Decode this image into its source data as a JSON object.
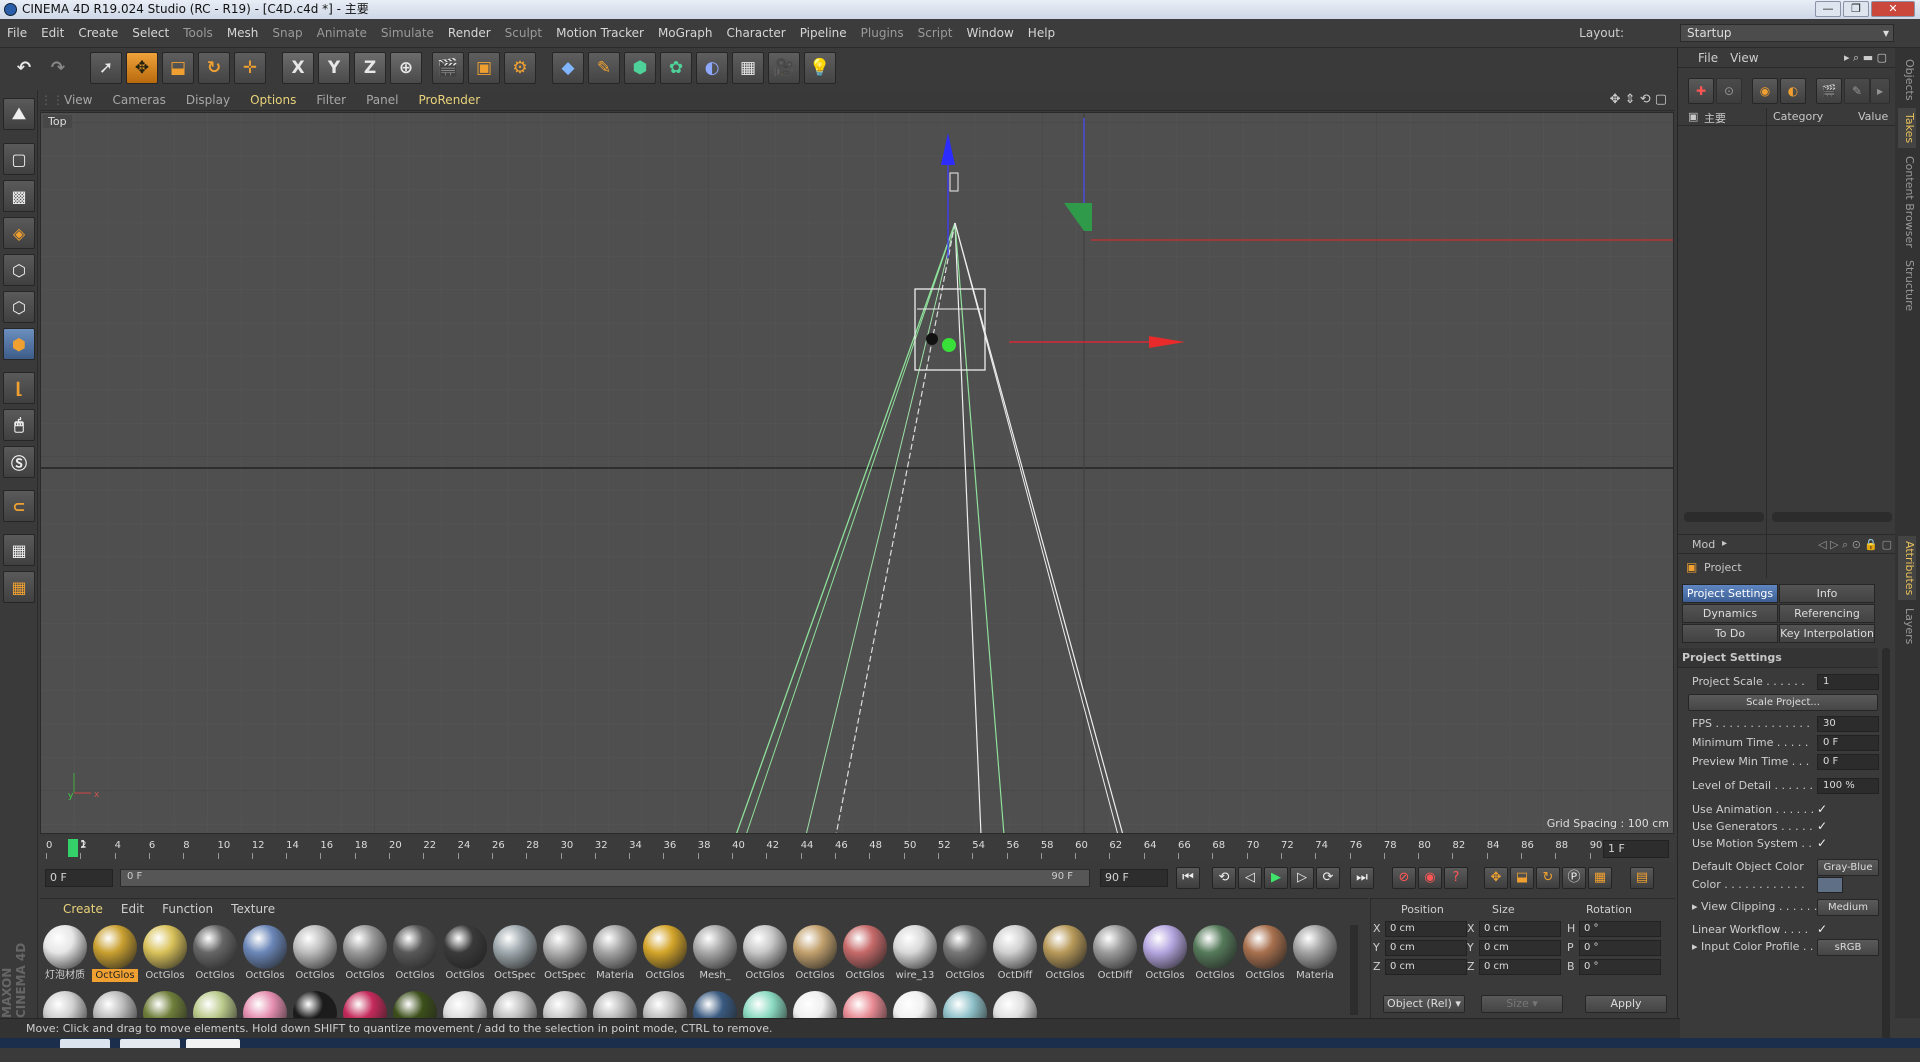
{
  "window": {
    "title": "CINEMA 4D R19.024 Studio (RC - R19) - [C4D.c4d *] - 主要",
    "controls": [
      "—",
      "❐",
      "✕"
    ]
  },
  "menu": [
    "File",
    "Edit",
    "Create",
    "Select",
    "Tools",
    "Mesh",
    "Snap",
    "Animate",
    "Simulate",
    "Render",
    "Sculpt",
    "Motion Tracker",
    "MoGraph",
    "Character",
    "Pipeline",
    "Plugins",
    "Script",
    "Window",
    "Help"
  ],
  "layout": {
    "label": "Layout:",
    "value": "Startup"
  },
  "toolbar": {
    "axis_x": "X",
    "axis_y": "Y",
    "axis_z": "Z"
  },
  "viewport": {
    "menu": [
      "View",
      "Cameras",
      "Display",
      "Options",
      "Filter",
      "Panel",
      "ProRender"
    ],
    "view_name": "Top",
    "grid_spacing": "Grid Spacing : 100 cm",
    "axis_x": "x",
    "axis_y": "y"
  },
  "timeline": {
    "ticks": [
      "0",
      "2",
      "4",
      "6",
      "8",
      "10",
      "12",
      "14",
      "16",
      "18",
      "20",
      "22",
      "24",
      "26",
      "28",
      "30",
      "32",
      "34",
      "36",
      "38",
      "40",
      "42",
      "44",
      "46",
      "48",
      "50",
      "52",
      "54",
      "56",
      "58",
      "60",
      "62",
      "64",
      "66",
      "68",
      "70",
      "72",
      "74",
      "76",
      "78",
      "80",
      "82",
      "84",
      "86",
      "88",
      "90"
    ],
    "current_frame_field": "1 F",
    "playhead_label": "1"
  },
  "transport": {
    "start": "0 F",
    "range_start": "0 F",
    "range_end": "90 F",
    "end": "90 F"
  },
  "materials": {
    "menu": [
      "Create",
      "Edit",
      "Function",
      "Texture"
    ],
    "row1": [
      {
        "name": "灯泡材质",
        "color": "#e6e6e6"
      },
      {
        "name": "OctGlos",
        "color": "#c9a030"
      },
      {
        "name": "OctGlos",
        "color": "#d9c25a"
      },
      {
        "name": "OctGlos",
        "color": "#666666"
      },
      {
        "name": "OctGlos",
        "color": "#6b87b8"
      },
      {
        "name": "OctGlos",
        "color": "#bdbdbd"
      },
      {
        "name": "OctGlos",
        "color": "#9a9a9a"
      },
      {
        "name": "OctGlos",
        "color": "#595959"
      },
      {
        "name": "OctGlos",
        "color": "#3a3a3a"
      },
      {
        "name": "OctSpec",
        "color": "#9ea8ad"
      },
      {
        "name": "OctSpec",
        "color": "#b0b0b0"
      },
      {
        "name": "Materia",
        "color": "#a5a5a5"
      },
      {
        "name": "OctGlos",
        "color": "#d4a52a"
      },
      {
        "name": "Mesh_",
        "color": "#a9a9a9"
      },
      {
        "name": "OctGlos",
        "color": "#c7c7c7"
      },
      {
        "name": "OctGlos",
        "color": "#c2a16e"
      },
      {
        "name": "OctGlos",
        "color": "#c76a6a"
      },
      {
        "name": "wire_13",
        "color": "#d9d9d9"
      },
      {
        "name": "OctGlos",
        "color": "#777777"
      },
      {
        "name": "OctDiff",
        "color": "#d0d0d0"
      },
      {
        "name": "OctGlos",
        "color": "#b89a5a"
      },
      {
        "name": "OctDiff",
        "color": "#9c9c9c"
      },
      {
        "name": "OctGlos",
        "color": "#b5a6e0"
      },
      {
        "name": "OctGlos",
        "color": "#557a5a"
      },
      {
        "name": "OctGlos",
        "color": "#a8704e"
      },
      {
        "name": "Materia",
        "color": "#a3a3a3"
      }
    ],
    "row2": [
      "#d0d0d0",
      "#bcbcbc",
      "#6f7f3a",
      "#b9c98a",
      "#e58fb0",
      "#1b1b1b",
      "#c42a5a",
      "#3c4f1a",
      "#dcdcdc",
      "#bfbfbf",
      "#c9c9c9",
      "#b8b8b8",
      "#bfbfbf",
      "#3a5a80",
      "#8ad9c0",
      "#efefef",
      "#e88b94",
      "#f0f0f0",
      "#8fc1c9",
      "#e0e0e0"
    ]
  },
  "coords": {
    "headers": [
      "Position",
      "Size",
      "Rotation"
    ],
    "rows": [
      {
        "a": "X",
        "av": "0 cm",
        "b": "X",
        "bv": "0 cm",
        "c": "H",
        "cv": "0 °"
      },
      {
        "a": "Y",
        "av": "0 cm",
        "b": "Y",
        "bv": "0 cm",
        "c": "P",
        "cv": "0 °"
      },
      {
        "a": "Z",
        "av": "0 cm",
        "b": "Z",
        "bv": "0 cm",
        "c": "B",
        "cv": "0 °"
      }
    ],
    "mode": "Object (Rel)",
    "size_mode": "Size",
    "apply": "Apply"
  },
  "status": "Move: Click and drag to move elements. Hold down SHIFT to quantize movement / add to the selection in point mode, CTRL to remove.",
  "objects": {
    "menu": [
      "File",
      "View"
    ],
    "root_name": "主要",
    "col_category": "Category",
    "col_value": "Value"
  },
  "attributes": {
    "mode_label": "Mod",
    "title": "Project",
    "tabs": [
      "Project Settings",
      "Info",
      "Dynamics",
      "Referencing",
      "To Do",
      "Key Interpolation"
    ],
    "section": "Project Settings",
    "rows": [
      {
        "label": "Project Scale . . . . . .",
        "value": "1",
        "kind": "field"
      },
      {
        "label": "",
        "value": "Scale Project...",
        "kind": "button"
      },
      {
        "label": "FPS . . . . . . . . . . . . . .",
        "value": "30",
        "kind": "field"
      },
      {
        "label": "Minimum Time . . . . .",
        "value": "0 F",
        "kind": "field"
      },
      {
        "label": "Preview Min Time . . .",
        "value": "0 F",
        "kind": "field"
      },
      {
        "label": "Level of Detail . . . . . .",
        "value": "100 %",
        "kind": "field"
      },
      {
        "label": "Use Animation . . . . . .",
        "value": "✓",
        "kind": "check"
      },
      {
        "label": "Use Generators . . . . .",
        "value": "✓",
        "kind": "check"
      },
      {
        "label": "Use Motion System . .",
        "value": "✓",
        "kind": "check"
      },
      {
        "label": "Default Object Color",
        "value": "Gray-Blue",
        "kind": "button"
      },
      {
        "label": "Color . . . . . . . . . . . .",
        "value": "",
        "kind": "swatch"
      },
      {
        "label": "▸ View Clipping . . . . . . .",
        "value": "Medium",
        "kind": "button"
      },
      {
        "label": "Linear Workflow . . . .",
        "value": "✓",
        "kind": "check"
      },
      {
        "label": "▸ Input Color Profile . .",
        "value": "sRGB",
        "kind": "button"
      }
    ]
  },
  "right_tabs": [
    "Objects",
    "Takes",
    "Content Browser",
    "Structure",
    "Attributes",
    "Layers"
  ]
}
